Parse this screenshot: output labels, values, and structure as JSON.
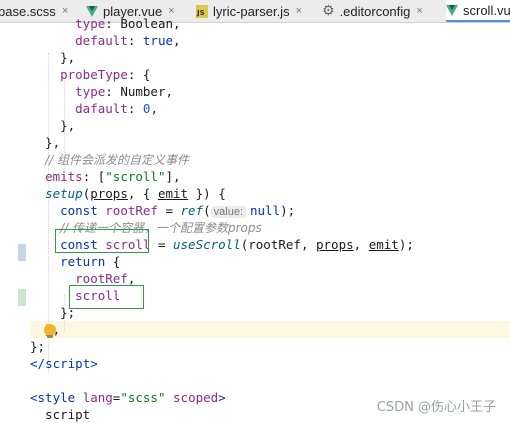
{
  "tabs": [
    {
      "label": "base.scss",
      "icon": "scss-file-icon"
    },
    {
      "label": "player.vue",
      "icon": "vue-file-icon"
    },
    {
      "label": "lyric-parser.js",
      "icon": "js-file-icon"
    },
    {
      "label": ".editorconfig",
      "icon": "gear-icon"
    },
    {
      "label": "scroll.vu",
      "icon": "vue-file-icon"
    }
  ],
  "close_glyph": "×",
  "code_lines": [
    [
      [
        "      ",
        "plain"
      ],
      [
        "type",
        "prop"
      ],
      [
        ": ",
        "plain"
      ],
      [
        "Boolean",
        "ident"
      ],
      [
        ",",
        "plain"
      ]
    ],
    [
      [
        "      ",
        "plain"
      ],
      [
        "default",
        "prop"
      ],
      [
        ": ",
        "plain"
      ],
      [
        "true",
        "kw"
      ],
      [
        ",",
        "plain"
      ]
    ],
    [
      [
        "    },",
        "plain"
      ]
    ],
    [
      [
        "    ",
        "plain"
      ],
      [
        "probeType",
        "prop"
      ],
      [
        ": {",
        "plain"
      ]
    ],
    [
      [
        "      ",
        "plain"
      ],
      [
        "type",
        "prop"
      ],
      [
        ": ",
        "plain"
      ],
      [
        "Number",
        "ident"
      ],
      [
        ",",
        "plain"
      ]
    ],
    [
      [
        "      ",
        "plain"
      ],
      [
        "dafault",
        "prop"
      ],
      [
        ": ",
        "plain"
      ],
      [
        "0",
        "num"
      ],
      [
        ",",
        "plain"
      ]
    ],
    [
      [
        "    },",
        "plain"
      ]
    ],
    [
      [
        "  },",
        "plain"
      ]
    ],
    [
      [
        "  ",
        "plain"
      ],
      [
        "// 组件会派发的自定义事件",
        "comment"
      ]
    ],
    [
      [
        "  ",
        "plain"
      ],
      [
        "emits",
        "prop"
      ],
      [
        ": [",
        "plain"
      ],
      [
        "\"scroll\"",
        "str"
      ],
      [
        "],",
        "plain"
      ]
    ],
    [
      [
        "  ",
        "plain"
      ],
      [
        "setup",
        "fn"
      ],
      [
        "(",
        "plain"
      ],
      [
        "props",
        "param"
      ],
      [
        ", { ",
        "plain"
      ],
      [
        "emit",
        "param"
      ],
      [
        " }) {",
        "plain"
      ]
    ],
    [
      [
        "    ",
        "plain"
      ],
      [
        "const ",
        "kw"
      ],
      [
        "rootRef",
        "prop"
      ],
      [
        " = ",
        "plain"
      ],
      [
        "ref",
        "fn"
      ],
      [
        "(",
        "plain"
      ],
      [
        "value:",
        "hint"
      ],
      [
        "null",
        "kw"
      ],
      [
        ");",
        "plain"
      ]
    ],
    [
      [
        "    ",
        "plain"
      ],
      [
        "// 传递一个容器，一个配置参数props",
        "comment"
      ]
    ],
    [
      [
        "    ",
        "plain"
      ],
      [
        "const ",
        "kw"
      ],
      [
        "scroll",
        "prop"
      ],
      [
        " = ",
        "plain"
      ],
      [
        "useScroll",
        "fn"
      ],
      [
        "(rootRef, ",
        "plain"
      ],
      [
        "props",
        "param"
      ],
      [
        ", ",
        "plain"
      ],
      [
        "emit",
        "param"
      ],
      [
        ");",
        "plain"
      ]
    ],
    [
      [
        "    ",
        "plain"
      ],
      [
        "return ",
        "kw"
      ],
      [
        "{",
        "plain"
      ]
    ],
    [
      [
        "      ",
        "plain"
      ],
      [
        "rootRef",
        "prop"
      ],
      [
        ",",
        "plain"
      ]
    ],
    [
      [
        "      ",
        "plain"
      ],
      [
        "scroll",
        "prop"
      ]
    ],
    [
      [
        "    };",
        "plain"
      ]
    ],
    [
      [
        "  },",
        "plain"
      ]
    ],
    [
      [
        "};",
        "plain"
      ]
    ],
    [
      [
        "</",
        "tag"
      ],
      [
        "script",
        "tag"
      ],
      [
        ">",
        "tag"
      ]
    ],
    [
      [
        "",
        "plain"
      ]
    ],
    [
      [
        "<",
        "tag"
      ],
      [
        "style ",
        "tag"
      ],
      [
        "lang",
        "prop"
      ],
      [
        "=",
        "plain"
      ],
      [
        "\"scss\"",
        "str"
      ],
      [
        " ",
        "plain"
      ],
      [
        "scoped",
        "prop"
      ],
      [
        ">",
        "tag"
      ]
    ],
    [
      [
        "  script",
        "plain"
      ]
    ]
  ],
  "watermark": "CSDN @伤心小王子"
}
